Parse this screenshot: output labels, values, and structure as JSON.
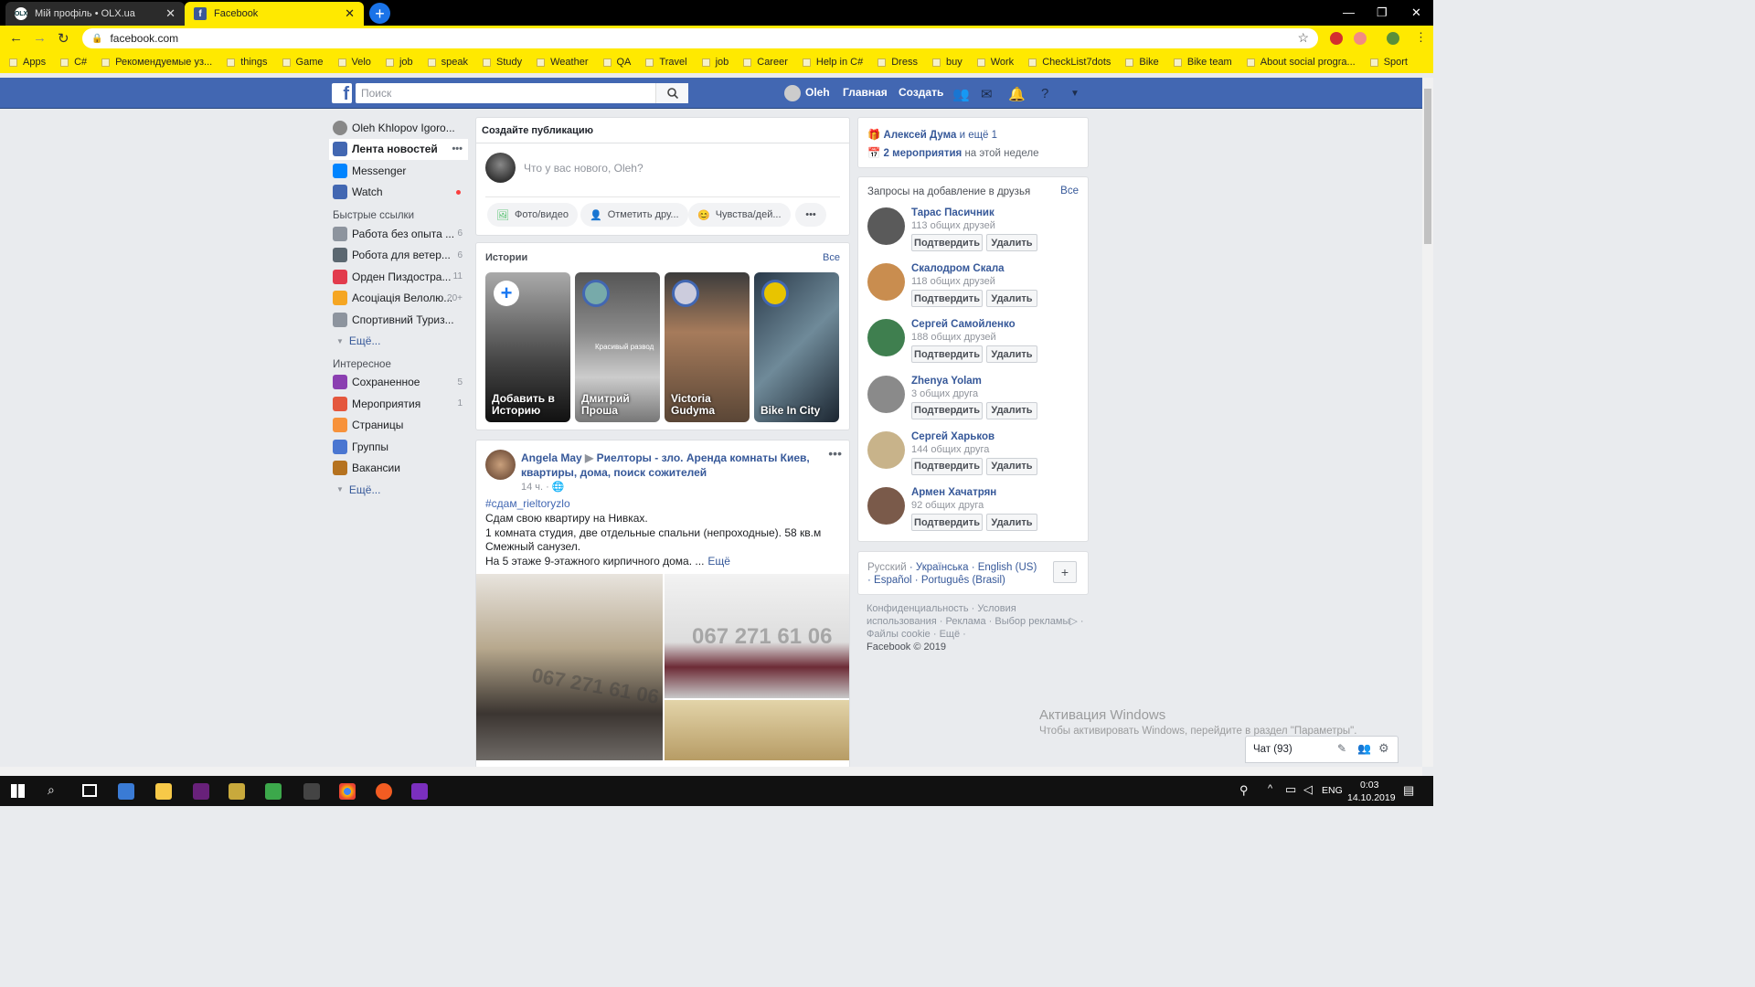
{
  "browser": {
    "tabs": [
      {
        "title": "Мій профіль • OLX.ua",
        "icon": "olx-icon",
        "active": false
      },
      {
        "title": "Facebook",
        "icon": "facebook-icon",
        "active": true
      }
    ],
    "url": "facebook.com",
    "bookmarks": [
      "Apps",
      "C#",
      "Рекомендуемые уз...",
      "things",
      "Game",
      "Velo",
      "job",
      "speak",
      "Study",
      "Weather",
      "QA",
      "Travel",
      "job",
      "Career",
      "Help in C#",
      "Dress",
      "buy",
      "Work",
      "CheckList7dots",
      "Bike",
      "Bike team",
      "About social progra...",
      "Sport"
    ]
  },
  "fb": {
    "search_placeholder": "Поиск",
    "user": "Oleh",
    "nav_home": "Главная",
    "nav_create": "Создать"
  },
  "left": {
    "profile": "Oleh Khlopov Igoro...",
    "main": [
      {
        "label": "Лента новостей",
        "color": "#4267b2"
      },
      {
        "label": "Messenger",
        "color": "#0084ff"
      },
      {
        "label": "Watch",
        "color": "#4267b2"
      }
    ],
    "quick_title": "Быстрые ссылки",
    "quick": [
      {
        "label": "Работа без опыта ...",
        "count": "6",
        "color": "#8d949e"
      },
      {
        "label": "Робота для ветер...",
        "count": "6",
        "color": "#5b6770"
      },
      {
        "label": "Орден Пиздостра...",
        "count": "11",
        "color": "#e23b4d"
      },
      {
        "label": "Асоціація Велолю...",
        "count": "20+",
        "color": "#f5a623"
      },
      {
        "label": "Спортивний Туриз...",
        "count": "",
        "color": "#8d949e"
      }
    ],
    "more": "Ещё...",
    "interest_title": "Интересное",
    "interest": [
      {
        "label": "Сохраненное",
        "count": "5",
        "color": "#8b3fb1"
      },
      {
        "label": "Мероприятия",
        "count": "1",
        "color": "#e4573d"
      },
      {
        "label": "Страницы",
        "count": "",
        "color": "#f7923b"
      },
      {
        "label": "Группы",
        "count": "",
        "color": "#4a76d1"
      },
      {
        "label": "Вакансии",
        "count": "",
        "color": "#b5721f"
      }
    ]
  },
  "composer": {
    "title": "Создайте публикацию",
    "placeholder": "Что у вас нового, Oleh?",
    "photo": "Фото/видео",
    "tag": "Отметить дру...",
    "feeling": "Чувства/дей..."
  },
  "stories": {
    "title": "Истории",
    "all": "Все",
    "items": [
      {
        "name": "Добавить в Историю"
      },
      {
        "name": "Дмитрий Проша",
        "overlay": "Красивый развод"
      },
      {
        "name": "Victoria Gudyma"
      },
      {
        "name": "Bike In City"
      }
    ]
  },
  "post": {
    "author": "Angela May",
    "group": "Риелторы - зло. Аренда комнаты Киев, квартиры, дома, поиск сожителей",
    "time": "14 ч. ·",
    "hashtag": "#сдам_rieltoryzlo",
    "lines": [
      "Сдам свою квартиру на Нивках.",
      "1 комната студия, две отдельные спальни (непроходные). 58 кв.м",
      "Смежный санузел.",
      "На 5 этаже 9-этажного кирпичного дома. ..."
    ],
    "more": "Ещё",
    "watermark": "067 271 61 06"
  },
  "right": {
    "bday_name": "Алексей Дума",
    "bday_rest": "и ещё 1",
    "events_count": "2 мероприятия",
    "events_rest": "на этой неделе",
    "requests_title": "Запросы на добавление в друзья",
    "requests_all": "Все",
    "confirm": "Подтвердить",
    "delete": "Удалить",
    "requests": [
      {
        "name": "Тарас Пасичник",
        "mutual": "113 общих друзей"
      },
      {
        "name": "Скалодром Скала",
        "mutual": "118 общих друзей"
      },
      {
        "name": "Сергей Самойленко",
        "mutual": "188 общих друзей"
      },
      {
        "name": "Zhenya Yolam",
        "mutual": "3 общих друга"
      },
      {
        "name": "Сергей Харьков",
        "mutual": "144 общих друга"
      },
      {
        "name": "Армен Хачатрян",
        "mutual": "92 общих друга"
      }
    ],
    "langs_current": "Русский",
    "langs": [
      "Українська",
      "English (US)",
      "Español",
      "Português (Brasil)"
    ],
    "footer": [
      "Конфиденциальность",
      "Условия использования",
      "Реклама",
      "Выбор рекламы",
      "Файлы cookie",
      "Ещё"
    ],
    "copyright": "Facebook © 2019"
  },
  "activation": {
    "title": "Активация Windows",
    "text": "Чтобы активировать Windows, перейдите в раздел \"Параметры\"."
  },
  "chat": {
    "label": "Чат (93)"
  },
  "taskbar": {
    "lang": "ENG",
    "time": "0:03",
    "date": "14.10.2019"
  }
}
